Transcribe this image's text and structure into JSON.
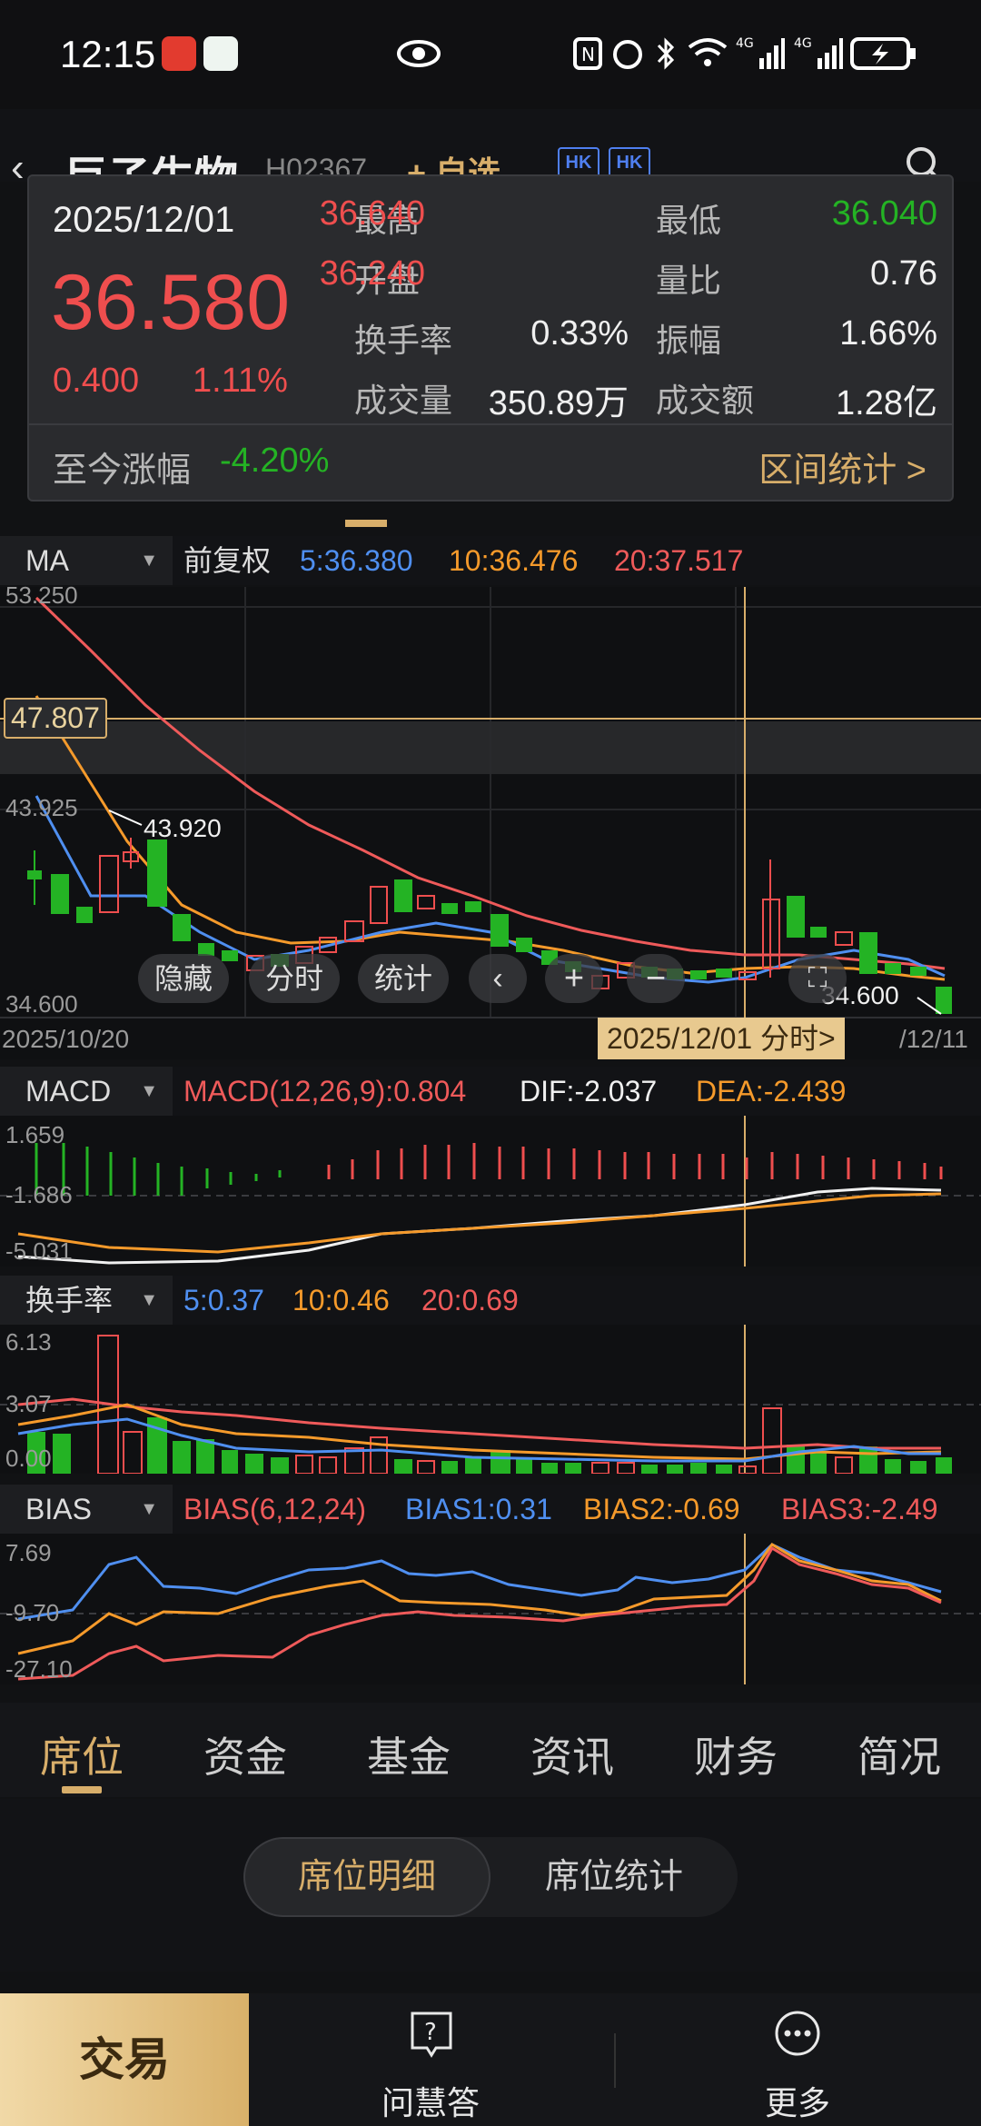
{
  "status_bar": {
    "time": "12:15"
  },
  "header": {
    "back_glyph": "‹",
    "stock_name": "巨子生物",
    "stock_code": "H02367",
    "add_watch": "+ 自选",
    "badges": [
      "HK",
      "HK"
    ]
  },
  "quote_card": {
    "date": "2025/12/01",
    "price": "36.580",
    "change": "0.400",
    "change_pct": "1.11%",
    "fields": {
      "high_label": "最高",
      "high": "36.640",
      "low_label": "最低",
      "low": "36.040",
      "open_label": "开盘",
      "open": "36.240",
      "vol_ratio_label": "量比",
      "vol_ratio": "0.76",
      "turnover_label": "换手率",
      "turnover": "0.33%",
      "amplitude_label": "振幅",
      "amplitude": "1.66%",
      "volume_label": "成交量",
      "volume": "350.89万",
      "amount_label": "成交额",
      "amount": "1.28亿"
    },
    "ytd_label": "至今涨幅",
    "ytd_value": "-4.20%",
    "range_stats": "区间统计 >"
  },
  "ma_row": {
    "name": "MA",
    "adjust": "前复权",
    "ma5": "5:36.380",
    "ma10": "10:36.476",
    "ma20": "20:37.517"
  },
  "kline": {
    "y_top": "53.250",
    "y_mid": "43.925",
    "y_bottom": "34.600",
    "crosshair_price": "47.807",
    "peak_label": "43.920",
    "low_label": "34.600",
    "start_date": "2025/10/20",
    "cursor_date": "2025/12/01 分时>",
    "end_date": "/12/11",
    "buttons": [
      "隐藏",
      "分时",
      "统计"
    ]
  },
  "macd_row": {
    "name": "MACD",
    "params": "MACD(12,26,9):0.804",
    "dif": "DIF:-2.037",
    "dea": "DEA:-2.439",
    "y_top": "1.659",
    "y_mid": "-1.686",
    "y_bottom": "-5.031"
  },
  "turnover_row": {
    "name": "换手率",
    "t5": "5:0.37",
    "t10": "10:0.46",
    "t20": "20:0.69",
    "y_top": "6.13",
    "y_mid": "3.07",
    "y_bottom": "0.00"
  },
  "bias_row": {
    "name": "BIAS",
    "params": "BIAS(6,12,24)",
    "b1": "BIAS1:0.31",
    "b2": "BIAS2:-0.69",
    "b3": "BIAS3:-2.49",
    "y_top": "7.69",
    "y_mid": "-9.70",
    "y_bottom": "-27.10"
  },
  "tabs": [
    "席位",
    "资金",
    "基金",
    "资讯",
    "财务",
    "简况"
  ],
  "seat_toggle": {
    "detail": "席位明细",
    "stats": "席位统计"
  },
  "bottom_bar": {
    "trade": "交易",
    "ask": "问慧答",
    "more": "更多"
  },
  "colors": {
    "up": "#ef4e4e",
    "down": "#24b324",
    "accent": "#d8ae6a",
    "ma5": "#4f8ff0",
    "ma10": "#f59a2b",
    "ma20": "#ef5a5a"
  }
}
